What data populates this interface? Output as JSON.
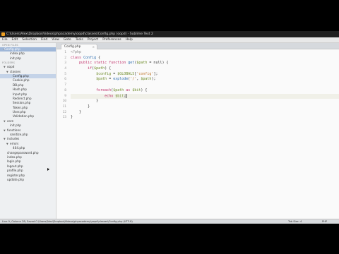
{
  "window": {
    "title": "C:\\Users\\Alex\\Dropbox\\Videos\\phpacademy\\oopd\\classes\\Config.php (oopd) - Sublime Text 2"
  },
  "menu": [
    "File",
    "Edit",
    "Selection",
    "Find",
    "View",
    "Goto",
    "Tools",
    "Project",
    "Preferences",
    "Help"
  ],
  "sidebar": {
    "open_files_title": "OPEN FILES",
    "folders_title": "FOLDERS",
    "rows": [
      {
        "type": "section",
        "label": "OPEN FILES"
      },
      {
        "type": "open",
        "label": "Config.php",
        "state": "open-selected"
      },
      {
        "type": "folder",
        "label": "index.php",
        "indent": 2
      },
      {
        "type": "folder",
        "label": "init.php",
        "indent": 2
      },
      {
        "type": "section",
        "label": "FOLDERS"
      },
      {
        "type": "folder",
        "label": "oopd",
        "indent": 1,
        "open": true
      },
      {
        "type": "folder",
        "label": "classes",
        "indent": 2,
        "open": true
      },
      {
        "type": "file",
        "label": "Config.php",
        "indent": 3,
        "state": "selected"
      },
      {
        "type": "file",
        "label": "Cookie.php",
        "indent": 3
      },
      {
        "type": "file",
        "label": "DB.php",
        "indent": 3
      },
      {
        "type": "file",
        "label": "Hash.php",
        "indent": 3
      },
      {
        "type": "file",
        "label": "Input.php",
        "indent": 3
      },
      {
        "type": "file",
        "label": "Redirect.php",
        "indent": 3
      },
      {
        "type": "file",
        "label": "Session.php",
        "indent": 3
      },
      {
        "type": "file",
        "label": "Token.php",
        "indent": 3
      },
      {
        "type": "file",
        "label": "User.php",
        "indent": 3
      },
      {
        "type": "file",
        "label": "Validation.php",
        "indent": 3
      },
      {
        "type": "folder",
        "label": "core",
        "indent": 1,
        "open": true
      },
      {
        "type": "file",
        "label": "init.php",
        "indent": 2
      },
      {
        "type": "folder",
        "label": "functions",
        "indent": 1,
        "open": true
      },
      {
        "type": "file",
        "label": "sanitize.php",
        "indent": 2
      },
      {
        "type": "folder",
        "label": "includes",
        "indent": 1,
        "open": true
      },
      {
        "type": "folder",
        "label": "errors",
        "indent": 2,
        "open": true
      },
      {
        "type": "file",
        "label": "404.php",
        "indent": 3
      },
      {
        "type": "file",
        "label": "changepassword.php",
        "indent": 1
      },
      {
        "type": "file",
        "label": "index.php",
        "indent": 1
      },
      {
        "type": "file",
        "label": "login.php",
        "indent": 1
      },
      {
        "type": "file",
        "label": "logout.php",
        "indent": 1
      },
      {
        "type": "file",
        "label": "profile.php",
        "indent": 1
      },
      {
        "type": "file",
        "label": "register.php",
        "indent": 1
      },
      {
        "type": "file",
        "label": "update.php",
        "indent": 1
      }
    ]
  },
  "tab": {
    "label": "Config.php",
    "close": "×"
  },
  "editor": {
    "current_line": 9,
    "lines": [
      [
        [
          "tag",
          "<?php"
        ]
      ],
      [
        [
          "kw",
          "class "
        ],
        [
          "fn",
          "Config"
        ],
        [
          "plain",
          " {"
        ]
      ],
      [
        [
          "plain",
          "    "
        ],
        [
          "kw",
          "public static function "
        ],
        [
          "fn",
          "get"
        ],
        [
          "plain",
          "("
        ],
        [
          "var",
          "$path"
        ],
        [
          "plain",
          " = null) {"
        ]
      ],
      [
        [
          "plain",
          "        "
        ],
        [
          "kw",
          "if"
        ],
        [
          "plain",
          "("
        ],
        [
          "var",
          "$path"
        ],
        [
          "plain",
          ") {"
        ]
      ],
      [
        [
          "plain",
          "            "
        ],
        [
          "var",
          "$config"
        ],
        [
          "plain",
          " = "
        ],
        [
          "var",
          "$GLOBALS"
        ],
        [
          "plain",
          "["
        ],
        [
          "str",
          "'config'"
        ],
        [
          "plain",
          "];"
        ]
      ],
      [
        [
          "plain",
          "            "
        ],
        [
          "var",
          "$path"
        ],
        [
          "plain",
          " = "
        ],
        [
          "fn",
          "explode"
        ],
        [
          "plain",
          "("
        ],
        [
          "str",
          "'/'"
        ],
        [
          "plain",
          ", "
        ],
        [
          "var",
          "$path"
        ],
        [
          "plain",
          ");"
        ]
      ],
      [],
      [
        [
          "plain",
          "            "
        ],
        [
          "kw",
          "foreach"
        ],
        [
          "plain",
          "("
        ],
        [
          "var",
          "$path"
        ],
        [
          "kw",
          " as "
        ],
        [
          "var",
          "$bit"
        ],
        [
          "plain",
          ") {"
        ]
      ],
      [
        [
          "plain",
          "                "
        ],
        [
          "kw",
          "echo "
        ],
        [
          "var",
          "$bit"
        ],
        [
          "plain",
          ";"
        ]
      ],
      [
        [
          "plain",
          "            }"
        ]
      ],
      [
        [
          "plain",
          "        }"
        ]
      ],
      [
        [
          "plain",
          "    }"
        ]
      ],
      [
        [
          "plain",
          "}"
        ]
      ]
    ]
  },
  "status": {
    "left": "Line 9, Column 28; Saved C:\\Users\\Alex\\Dropbox\\Videos\\phpacademy\\oopd\\classes\\Config.php (UTF-8)",
    "tab_size": "Tab Size: 4",
    "syntax": "PHP"
  }
}
